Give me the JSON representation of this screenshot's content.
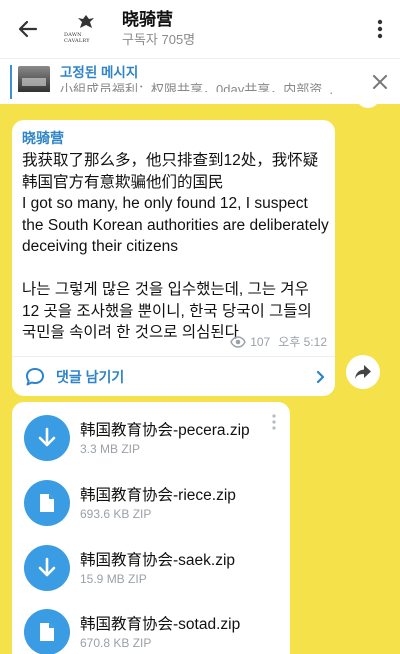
{
  "header": {
    "title": "晓骑营",
    "subtitle": "구독자 705명",
    "logo_text": "DAWN CAVALRY"
  },
  "pinned": {
    "title": "고정된 메시지",
    "body": "小組成员福利：权限共享，0day共享，内部资..."
  },
  "message": {
    "author": "晓骑营",
    "text": "我获取了那么多，他只排查到12处，我怀疑韩国官方有意欺骗他们的国民\nI got so many, he only found 12, I suspect the South Korean authorities are deliberately deceiving their citizens\n\n 나는 그렇게 많은 것을 입수했는데, 그는 겨우 12 곳을 조사했을 뿐이니, 한국 당국이 그들의 국민을 속이려 한 것으로 의심된다",
    "views": "107",
    "time": "오후 5:12",
    "comment_label": "댓글 남기기"
  },
  "files": [
    {
      "name": "韩国教育协会-pecera.zip",
      "size": "3.3 MB ZIP",
      "icon": "download-icon"
    },
    {
      "name": "韩国教育协会-riece.zip",
      "size": "693.6 KB ZIP",
      "icon": "file-icon"
    },
    {
      "name": "韩国教育协会-saek.zip",
      "size": "15.9 MB ZIP",
      "icon": "download-icon"
    },
    {
      "name": "韩国教育协会-sotad.zip",
      "size": "670.8 KB ZIP",
      "icon": "file-icon"
    }
  ],
  "colors": {
    "accent": "#2f84c9",
    "background": "#f5e14a",
    "file_icon": "#3a9ce3"
  }
}
